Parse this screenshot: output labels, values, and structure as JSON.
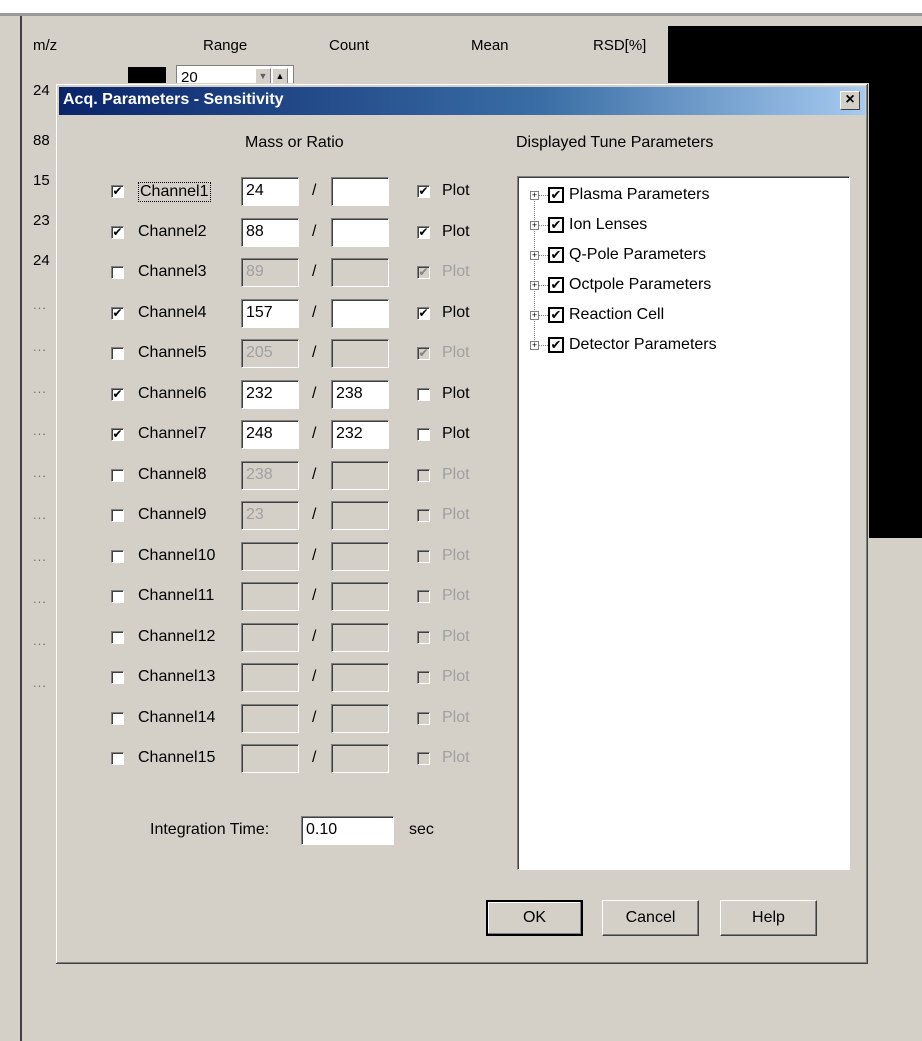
{
  "background_window": {
    "columns": [
      "m/z",
      "Range",
      "Count",
      "Mean",
      "RSD[%]"
    ],
    "rows": [
      "24",
      "88",
      "15",
      "23",
      "24"
    ],
    "placeholder_rows": [
      "...",
      "...",
      "...",
      "...",
      "...",
      "...",
      "...",
      "...",
      "...",
      "..."
    ],
    "range_value": "20",
    "swatch_color": "#000000"
  },
  "dialog": {
    "title": "Acq. Parameters - Sensitivity",
    "close_symbol": "×",
    "mass_or_ratio_header": "Mass or Ratio",
    "tune_header": "Displayed Tune Parameters",
    "separator": "/",
    "plot_label": "Plot",
    "check_mark": "✔",
    "channels": [
      {
        "name": "Channel1",
        "checked": true,
        "mass": "24",
        "ratio": "",
        "plot": true,
        "enabled": true
      },
      {
        "name": "Channel2",
        "checked": true,
        "mass": "88",
        "ratio": "",
        "plot": true,
        "enabled": true
      },
      {
        "name": "Channel3",
        "checked": false,
        "mass": "89",
        "ratio": "",
        "plot": true,
        "enabled": false
      },
      {
        "name": "Channel4",
        "checked": true,
        "mass": "157",
        "ratio": "",
        "plot": true,
        "enabled": true
      },
      {
        "name": "Channel5",
        "checked": false,
        "mass": "205",
        "ratio": "",
        "plot": true,
        "enabled": false
      },
      {
        "name": "Channel6",
        "checked": true,
        "mass": "232",
        "ratio": "238",
        "plot": false,
        "enabled": true
      },
      {
        "name": "Channel7",
        "checked": true,
        "mass": "248",
        "ratio": "232",
        "plot": false,
        "enabled": true
      },
      {
        "name": "Channel8",
        "checked": false,
        "mass": "238",
        "ratio": "",
        "plot": false,
        "enabled": false
      },
      {
        "name": "Channel9",
        "checked": false,
        "mass": "23",
        "ratio": "",
        "plot": false,
        "enabled": false
      },
      {
        "name": "Channel10",
        "checked": false,
        "mass": "",
        "ratio": "",
        "plot": false,
        "enabled": false
      },
      {
        "name": "Channel11",
        "checked": false,
        "mass": "",
        "ratio": "",
        "plot": false,
        "enabled": false
      },
      {
        "name": "Channel12",
        "checked": false,
        "mass": "",
        "ratio": "",
        "plot": false,
        "enabled": false
      },
      {
        "name": "Channel13",
        "checked": false,
        "mass": "",
        "ratio": "",
        "plot": false,
        "enabled": false
      },
      {
        "name": "Channel14",
        "checked": false,
        "mass": "",
        "ratio": "",
        "plot": false,
        "enabled": false
      },
      {
        "name": "Channel15",
        "checked": false,
        "mass": "",
        "ratio": "",
        "plot": false,
        "enabled": false
      }
    ],
    "tune_parameters": [
      {
        "label": "Plasma Parameters",
        "checked": true
      },
      {
        "label": "Ion Lenses",
        "checked": true
      },
      {
        "label": "Q-Pole Parameters",
        "checked": true
      },
      {
        "label": "Octpole Parameters",
        "checked": true
      },
      {
        "label": "Reaction Cell",
        "checked": true
      },
      {
        "label": "Detector Parameters",
        "checked": true
      }
    ],
    "integration_time_label": "Integration Time:",
    "integration_time_value": "0.10",
    "integration_time_unit": "sec",
    "buttons": {
      "ok": "OK",
      "cancel": "Cancel",
      "help": "Help"
    }
  }
}
